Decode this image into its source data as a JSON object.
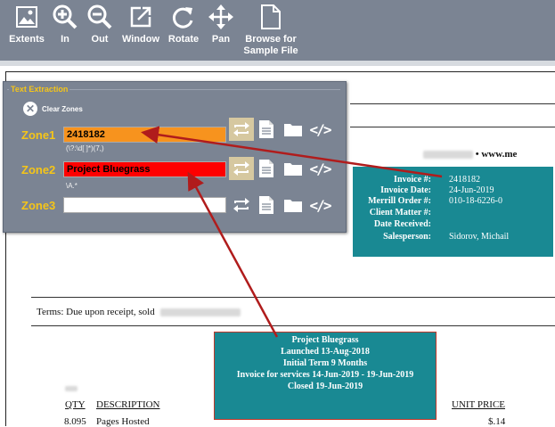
{
  "toolbar": {
    "items": [
      {
        "label": "Extents",
        "icon": "image-icon"
      },
      {
        "label": "In",
        "icon": "zoom-in-icon"
      },
      {
        "label": "Out",
        "icon": "zoom-out-icon"
      },
      {
        "label": "Window",
        "icon": "window-icon"
      },
      {
        "label": "Rotate",
        "icon": "rotate-icon"
      },
      {
        "label": "Pan",
        "icon": "pan-icon"
      },
      {
        "label": "Browse for Sample File",
        "icon": "file-icon"
      }
    ]
  },
  "panel": {
    "title": "Text Extraction",
    "clear_label": "Clear Zones",
    "zones": [
      {
        "label": "Zone1",
        "value": "2418182",
        "regex": "(\\?:\\d[ ]*)(7,)",
        "fill": "#f7931e"
      },
      {
        "label": "Zone2",
        "value": "Project Bluegrass",
        "regex": "\\A.*",
        "fill": "#ff0000"
      },
      {
        "label": "Zone3",
        "value": "",
        "regex": "",
        "fill": "#ffffff"
      }
    ],
    "code_symbol": "</>"
  },
  "document": {
    "website": "• www.me",
    "terms": "Terms:  Due upon receipt, sold",
    "columns": {
      "qty": "QTY",
      "description": "DESCRIPTION",
      "unit_price": "UNIT PRICE"
    },
    "row": {
      "qty": "8.095",
      "description": "Pages Hosted",
      "price": "$.14"
    }
  },
  "invoice_box": {
    "rows": [
      {
        "label": "Invoice #:",
        "value": "2418182"
      },
      {
        "label": "Invoice Date:",
        "value": "24-Jun-2019"
      },
      {
        "label": "Merrill Order #:",
        "value": "010-18-6226-0"
      },
      {
        "label": "Client Matter #:",
        "value": ""
      },
      {
        "label": "Date Received:",
        "value": ""
      },
      {
        "label": "Salesperson:",
        "value": "Sidorov, Michail"
      }
    ]
  },
  "project_box": {
    "lines": [
      "Project Bluegrass",
      "Launched 13-Aug-2018",
      "Initial Term 9 Months",
      "Invoice for services 14-Jun-2019 - 19-Jun-2019",
      "Closed 19-Jun-2019"
    ]
  },
  "colors": {
    "toolbar": "#7b8493",
    "accent": "#f5c518",
    "teal": "#198993",
    "arrow": "#b01c1c"
  }
}
